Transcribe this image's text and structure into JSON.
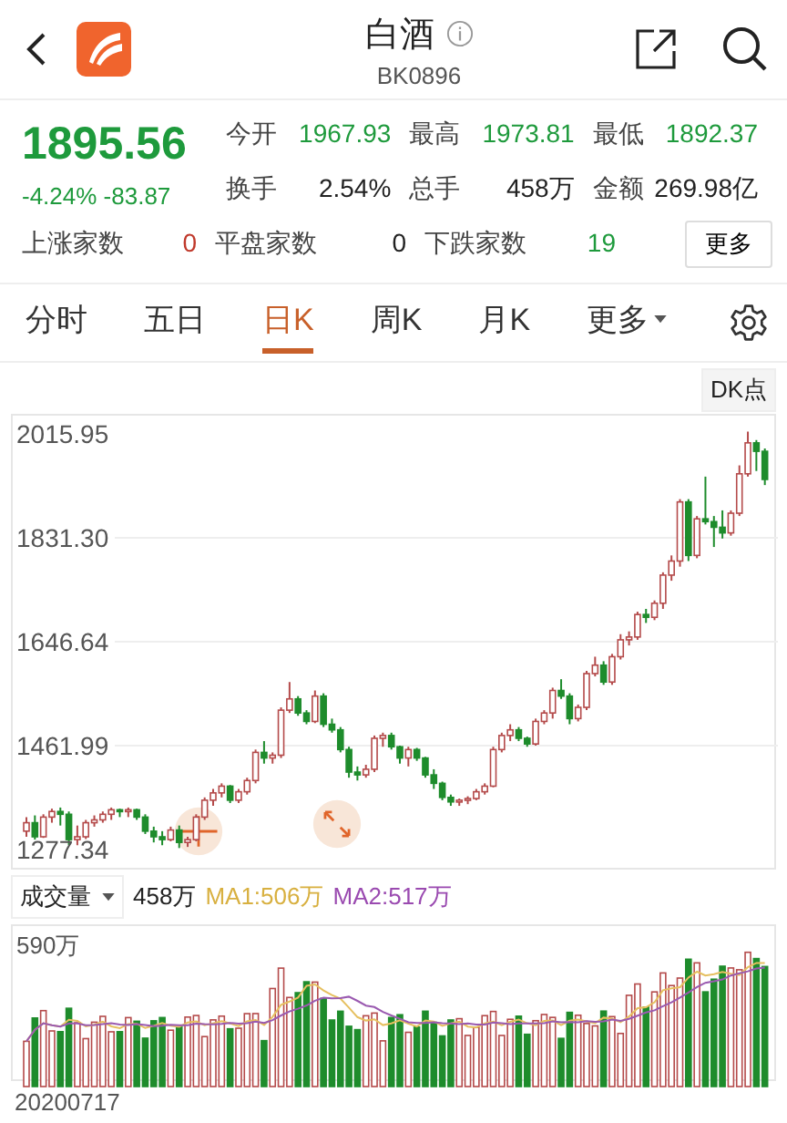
{
  "header": {
    "title": "白酒",
    "code": "BK0896"
  },
  "quote": {
    "price": "1895.56",
    "change_pct": "-4.24%",
    "change": "-83.87",
    "stats": [
      {
        "label": "今开",
        "value": "1967.93",
        "color": "#1e9a3c"
      },
      {
        "label": "最高",
        "value": "1973.81",
        "color": "#1e9a3c"
      },
      {
        "label": "最低",
        "value": "1892.37",
        "color": "#1e9a3c"
      },
      {
        "label": "换手",
        "value": "2.54%",
        "color": "#222222"
      },
      {
        "label": "总手",
        "value": "458万",
        "color": "#222222"
      },
      {
        "label": "金额",
        "value": "269.98亿",
        "color": "#222222"
      }
    ],
    "counts": [
      {
        "label": "上涨家数",
        "value": "0",
        "color": "#c0392b"
      },
      {
        "label": "平盘家数",
        "value": "0",
        "color": "#222222"
      },
      {
        "label": "下跌家数",
        "value": "19",
        "color": "#1e9a3c"
      }
    ],
    "more_button": "更多"
  },
  "tabs": [
    {
      "label": "分时",
      "selected": false,
      "kind": "text"
    },
    {
      "label": "五日",
      "selected": false,
      "kind": "text"
    },
    {
      "label": "日K",
      "selected": true,
      "kind": "text"
    },
    {
      "label": "周K",
      "selected": false,
      "kind": "text"
    },
    {
      "label": "月K",
      "selected": false,
      "kind": "text"
    },
    {
      "label": "更多",
      "selected": false,
      "kind": "dropdown"
    }
  ],
  "dk_button": "DK点",
  "chart": {
    "chart_data": {
      "type": "candlestick",
      "ylim": [
        1277.34,
        2015.95
      ],
      "grid": true,
      "yticks": [
        {
          "value": 2015.95,
          "label": "2015.95"
        },
        {
          "value": 1831.3,
          "label": "1831.30"
        },
        {
          "value": 1646.64,
          "label": "1646.64"
        },
        {
          "value": 1461.99,
          "label": "1461.99"
        },
        {
          "value": 1277.34,
          "label": "1277.34"
        }
      ],
      "ohlc": [
        [
          1310,
          1335,
          1300,
          1325
        ],
        [
          1325,
          1338,
          1295,
          1300
        ],
        [
          1300,
          1340,
          1298,
          1335
        ],
        [
          1335,
          1350,
          1325,
          1345
        ],
        [
          1345,
          1352,
          1320,
          1340
        ],
        [
          1340,
          1345,
          1285,
          1295
        ],
        [
          1295,
          1320,
          1285,
          1300
        ],
        [
          1300,
          1330,
          1296,
          1325
        ],
        [
          1325,
          1338,
          1318,
          1330
        ],
        [
          1330,
          1345,
          1325,
          1340
        ],
        [
          1340,
          1352,
          1330,
          1348
        ],
        [
          1348,
          1350,
          1335,
          1345
        ],
        [
          1345,
          1352,
          1335,
          1348
        ],
        [
          1348,
          1350,
          1330,
          1335
        ],
        [
          1335,
          1340,
          1305,
          1310
        ],
        [
          1310,
          1318,
          1290,
          1300
        ],
        [
          1300,
          1310,
          1285,
          1295
        ],
        [
          1295,
          1318,
          1292,
          1312
        ],
        [
          1312,
          1320,
          1280,
          1290
        ],
        [
          1290,
          1300,
          1282,
          1295
        ],
        [
          1295,
          1340,
          1292,
          1335
        ],
        [
          1335,
          1370,
          1330,
          1365
        ],
        [
          1365,
          1385,
          1355,
          1378
        ],
        [
          1378,
          1395,
          1370,
          1390
        ],
        [
          1390,
          1392,
          1360,
          1365
        ],
        [
          1365,
          1385,
          1360,
          1380
        ],
        [
          1380,
          1405,
          1375,
          1400
        ],
        [
          1400,
          1455,
          1395,
          1450
        ],
        [
          1450,
          1470,
          1430,
          1440
        ],
        [
          1440,
          1450,
          1430,
          1445
        ],
        [
          1445,
          1530,
          1440,
          1525
        ],
        [
          1525,
          1575,
          1520,
          1545
        ],
        [
          1545,
          1550,
          1515,
          1520
        ],
        [
          1520,
          1525,
          1500,
          1505
        ],
        [
          1505,
          1560,
          1502,
          1550
        ],
        [
          1550,
          1555,
          1495,
          1500
        ],
        [
          1500,
          1510,
          1485,
          1490
        ],
        [
          1490,
          1495,
          1450,
          1455
        ],
        [
          1455,
          1460,
          1405,
          1415
        ],
        [
          1415,
          1425,
          1400,
          1410
        ],
        [
          1410,
          1428,
          1405,
          1420
        ],
        [
          1420,
          1480,
          1415,
          1475
        ],
        [
          1475,
          1485,
          1460,
          1480
        ],
        [
          1480,
          1485,
          1455,
          1460
        ],
        [
          1460,
          1462,
          1430,
          1440
        ],
        [
          1440,
          1460,
          1425,
          1455
        ],
        [
          1455,
          1458,
          1435,
          1440
        ],
        [
          1440,
          1442,
          1405,
          1410
        ],
        [
          1410,
          1420,
          1385,
          1395
        ],
        [
          1395,
          1398,
          1365,
          1370
        ],
        [
          1370,
          1375,
          1355,
          1362
        ],
        [
          1362,
          1368,
          1355,
          1365
        ],
        [
          1365,
          1372,
          1358,
          1368
        ],
        [
          1368,
          1385,
          1365,
          1380
        ],
        [
          1380,
          1395,
          1375,
          1390
        ],
        [
          1390,
          1460,
          1388,
          1455
        ],
        [
          1455,
          1485,
          1450,
          1480
        ],
        [
          1480,
          1500,
          1470,
          1490
        ],
        [
          1490,
          1495,
          1470,
          1475
        ],
        [
          1475,
          1478,
          1460,
          1465
        ],
        [
          1465,
          1510,
          1462,
          1505
        ],
        [
          1505,
          1525,
          1500,
          1520
        ],
        [
          1520,
          1565,
          1510,
          1560
        ],
        [
          1560,
          1580,
          1545,
          1550
        ],
        [
          1550,
          1555,
          1500,
          1510
        ],
        [
          1510,
          1535,
          1505,
          1530
        ],
        [
          1530,
          1595,
          1525,
          1590
        ],
        [
          1590,
          1620,
          1585,
          1605
        ],
        [
          1605,
          1612,
          1570,
          1575
        ],
        [
          1575,
          1625,
          1570,
          1620
        ],
        [
          1620,
          1660,
          1615,
          1650
        ],
        [
          1650,
          1665,
          1640,
          1655
        ],
        [
          1655,
          1700,
          1650,
          1695
        ],
        [
          1695,
          1705,
          1680,
          1690
        ],
        [
          1690,
          1720,
          1685,
          1715
        ],
        [
          1715,
          1770,
          1705,
          1765
        ],
        [
          1765,
          1800,
          1755,
          1790
        ],
        [
          1790,
          1900,
          1780,
          1895
        ],
        [
          1895,
          1900,
          1790,
          1800
        ],
        [
          1800,
          1870,
          1795,
          1865
        ],
        [
          1865,
          1940,
          1855,
          1860
        ],
        [
          1860,
          1870,
          1815,
          1850
        ],
        [
          1850,
          1880,
          1830,
          1840
        ],
        [
          1840,
          1880,
          1835,
          1875
        ],
        [
          1875,
          1960,
          1870,
          1945
        ],
        [
          1945,
          2020,
          1940,
          2000
        ],
        [
          2000,
          2005,
          1950,
          1985
        ],
        [
          1985,
          1990,
          1925,
          1935
        ]
      ]
    }
  },
  "volume": {
    "selector": "成交量",
    "value": "458万",
    "ma1": "MA1:506万",
    "ma2": "MA2:517万",
    "y_label": "590万",
    "date": "20200717"
  }
}
